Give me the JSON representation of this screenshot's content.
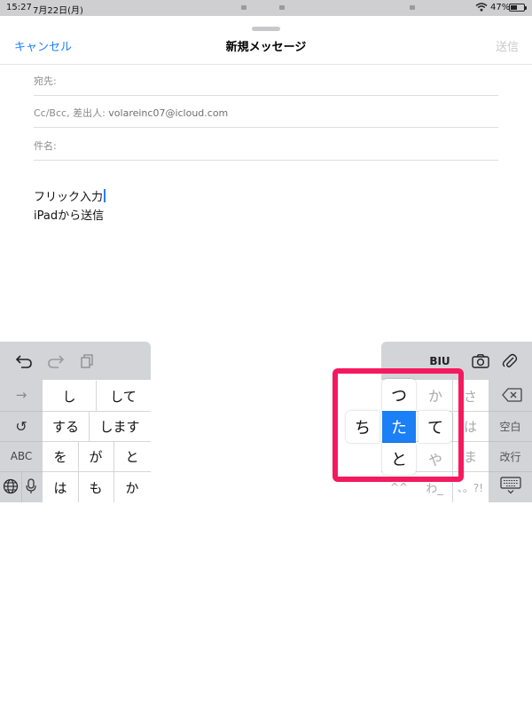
{
  "status_bar": {
    "time": "15:27",
    "date": "7月22日(月)",
    "battery": "47%"
  },
  "nav": {
    "cancel": "キャンセル",
    "title": "新規メッセージ",
    "send": "送信"
  },
  "fields": {
    "to_label": "宛先:",
    "cc_label": "Cc/Bcc, 差出人:",
    "cc_value": "volareinc07@icloud.com",
    "subject_label": "件名:"
  },
  "body": {
    "line1": "フリック入力",
    "line2": "iPadから送信"
  },
  "keyboard": {
    "toolbar_format": "BIU",
    "candidates": [
      [
        "し",
        "して"
      ],
      [
        "する",
        "します"
      ],
      [
        "を",
        "が",
        "と"
      ],
      [
        "は",
        "も",
        "か"
      ]
    ],
    "left_side_keys": {
      "next": "→",
      "undo_char": "↺",
      "abc": "ABC"
    },
    "right_keys": {
      "sa": "さ",
      "ha": "は",
      "ma": "ま",
      "ya": "や",
      "wa": "わ_",
      "dakuten": "^^",
      "punct": "、。?!",
      "space": "空白",
      "return": "改行"
    },
    "flick": {
      "center": "た",
      "left": "ち",
      "up": "つ",
      "right": "て",
      "down": "と",
      "ka": "か",
      "ya": "や"
    }
  }
}
